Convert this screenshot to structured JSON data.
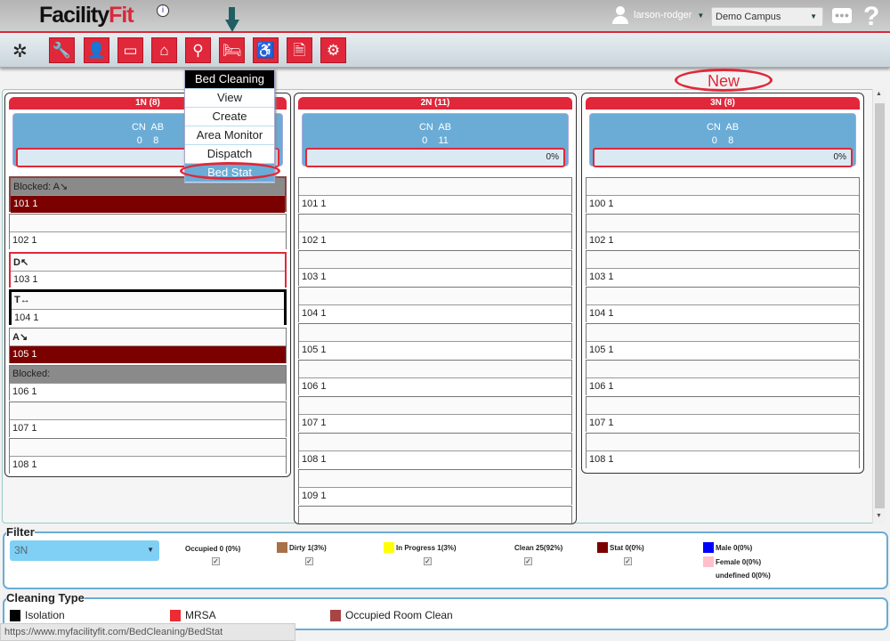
{
  "header": {
    "logo_main": "Facility",
    "logo_accent": "Fit",
    "info_icon": "i",
    "user": "larson-rodger",
    "campus": "Demo Campus",
    "help": "?"
  },
  "toolbar": {
    "icons": [
      "compass-icon",
      "wrench-icon",
      "user-icon",
      "monitor-icon",
      "house-icon",
      "search-icon",
      "bed-icon",
      "wheelchair-icon",
      "document-icon",
      "gears-icon"
    ],
    "glyphs": [
      "✲",
      "🔧",
      "👤",
      "▭",
      "⌂",
      "⚲",
      "🛏",
      "♿",
      "🗎",
      "⚙"
    ]
  },
  "menu": {
    "items": [
      "Bed Cleaning",
      "View",
      "Create",
      "Area Monitor",
      "Dispatch",
      "Bed Stat"
    ]
  },
  "annotation": {
    "new_label": "New"
  },
  "columns": [
    {
      "title": "1N (8)",
      "cn_label": "CN",
      "ab_label": "AB",
      "cn": "0",
      "ab": "8",
      "progress": "",
      "beds": [
        {
          "status": "Blocked: A↘",
          "label": "101 1",
          "type": "blocked-stat"
        },
        {
          "status": "",
          "label": "102 1"
        },
        {
          "status": "D↖",
          "label": "103 1",
          "type": "red"
        },
        {
          "status": "T↔",
          "label": "104 1",
          "type": "black"
        },
        {
          "status": "A↘",
          "label": "105 1",
          "type": "stat"
        },
        {
          "status": "Blocked:",
          "label": "106 1",
          "type": "blocked"
        },
        {
          "status": "",
          "label": "107 1"
        },
        {
          "status": "",
          "label": "108 1"
        }
      ]
    },
    {
      "title": "2N (11)",
      "cn_label": "CN",
      "ab_label": "AB",
      "cn": "0",
      "ab": "11",
      "progress": "0%",
      "beds": [
        {
          "status": "",
          "label": "101 1"
        },
        {
          "status": "",
          "label": "102 1"
        },
        {
          "status": "",
          "label": "103 1"
        },
        {
          "status": "",
          "label": "104 1"
        },
        {
          "status": "",
          "label": "105 1"
        },
        {
          "status": "",
          "label": "106 1"
        },
        {
          "status": "",
          "label": "107 1"
        },
        {
          "status": "",
          "label": "108 1"
        },
        {
          "status": "",
          "label": "109 1"
        },
        {
          "status": "",
          "label": ""
        }
      ]
    },
    {
      "title": "3N (8)",
      "cn_label": "CN",
      "ab_label": "AB",
      "cn": "0",
      "ab": "8",
      "progress": "0%",
      "beds": [
        {
          "status": "",
          "label": "100 1"
        },
        {
          "status": "",
          "label": "102 1"
        },
        {
          "status": "",
          "label": "103 1"
        },
        {
          "status": "",
          "label": "104 1"
        },
        {
          "status": "",
          "label": "105 1"
        },
        {
          "status": "",
          "label": "106 1"
        },
        {
          "status": "",
          "label": "107 1"
        },
        {
          "status": "",
          "label": "108 1"
        }
      ]
    }
  ],
  "filter": {
    "legend": "Filter",
    "selected": "3N",
    "items": [
      {
        "label": "Occupied 0 (0%)",
        "color": "",
        "checked": true
      },
      {
        "label": "Dirty 1(3%)",
        "color": "#a87148",
        "checked": true
      },
      {
        "label": "In Progress 1(3%)",
        "color": "#ffff00",
        "checked": true
      },
      {
        "label": "Clean 25(92%)",
        "color": "#ffffff",
        "checked": true
      },
      {
        "label": "Stat 0(0%)",
        "color": "#7b0000",
        "checked": true
      }
    ],
    "gender": [
      {
        "label": "Male 0(0%)",
        "color": "#0000ff"
      },
      {
        "label": "Female 0(0%)",
        "color": "#ffc0cb"
      },
      {
        "label": "undefined 0(0%)",
        "color": ""
      }
    ]
  },
  "cleaning_type": {
    "legend": "Cleaning Type",
    "items": [
      {
        "label": "Isolation",
        "color": "#000000"
      },
      {
        "label": "MRSA",
        "color": "#ee2a35"
      },
      {
        "label": "Occupied Room Clean",
        "color": "#a84444"
      }
    ]
  },
  "status_bar": {
    "url": "https://www.myfacilityfit.com/BedCleaning/BedStat"
  }
}
